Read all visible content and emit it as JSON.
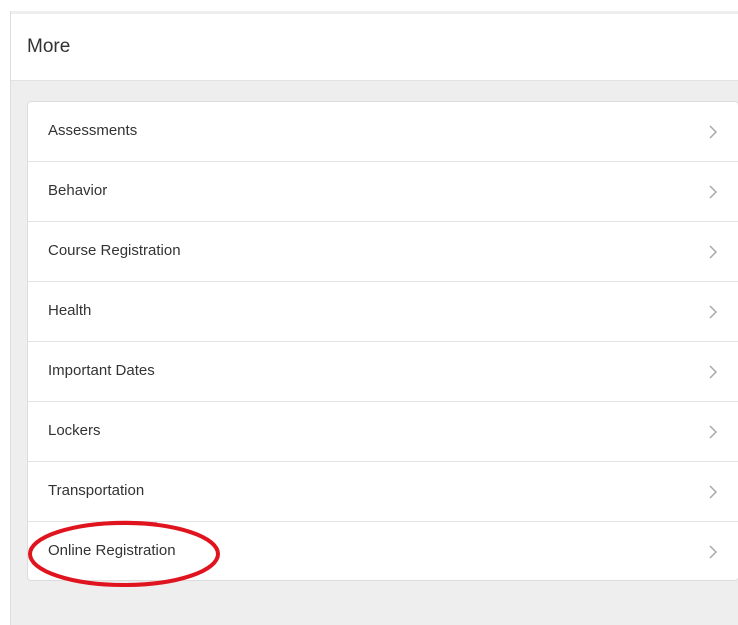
{
  "header": {
    "title": "More"
  },
  "menu": {
    "items": [
      {
        "label": "Assessments",
        "icon": "chevron-right-icon"
      },
      {
        "label": "Behavior",
        "icon": "chevron-right-icon"
      },
      {
        "label": "Course Registration",
        "icon": "chevron-right-icon"
      },
      {
        "label": "Health",
        "icon": "chevron-right-icon"
      },
      {
        "label": "Important Dates",
        "icon": "chevron-right-icon"
      },
      {
        "label": "Lockers",
        "icon": "chevron-right-icon"
      },
      {
        "label": "Transportation",
        "icon": "chevron-right-icon"
      },
      {
        "label": "Online Registration",
        "icon": "chevron-right-icon"
      }
    ]
  },
  "annotation": {
    "highlighted_item": "Online Registration",
    "shape": "ellipse",
    "color": "#e0141e"
  },
  "colors": {
    "accent": "#8cc63f",
    "background": "#eeeeee",
    "card": "#ffffff",
    "text": "#333333",
    "chevron": "#aaaaaa"
  }
}
